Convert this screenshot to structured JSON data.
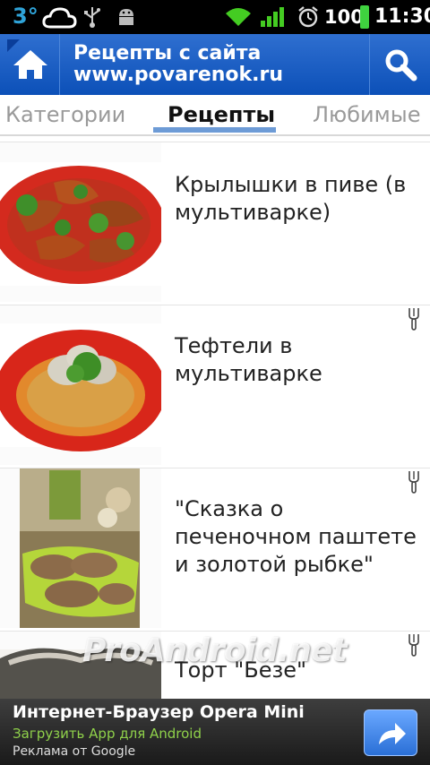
{
  "status_bar": {
    "temperature": "3°",
    "battery": "100",
    "time": "11:30",
    "icons": [
      "cloud-icon",
      "usb-icon",
      "android-debug-icon",
      "wifi-icon",
      "signal-icon",
      "alarm-icon",
      "battery-icon"
    ]
  },
  "action_bar": {
    "title": "Рецепты с сайта www.povarenok.ru",
    "home_icon": "home-icon",
    "search_icon": "search-icon",
    "accent": "#1a5ec6"
  },
  "tabs": {
    "left": "Категории",
    "active": "Рецепты",
    "right": "Любимые"
  },
  "recipes": [
    {
      "title": "Крылышки в пиве (в мультиварке)",
      "image": "chicken-wings-photo"
    },
    {
      "title": "Тефтели в мультиварке",
      "image": "meatballs-photo"
    },
    {
      "title": "\"Сказка о печеночном паштете и золотой рыбке\"",
      "image": "liver-pate-photo"
    },
    {
      "title": "Торт \"Безе\"",
      "image": "meringue-cake-photo"
    }
  ],
  "watermark": "ProAndroid.net",
  "ad": {
    "title": "Интернет-Браузер Opera Mini",
    "subtitle": "Загрузить App для Android",
    "source": "Реклама от Google",
    "button_icon": "share-arrow-icon"
  }
}
